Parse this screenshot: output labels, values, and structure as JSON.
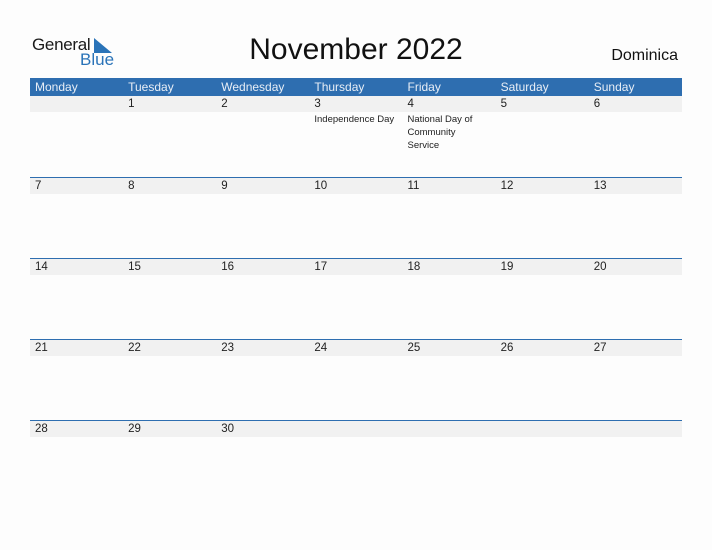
{
  "logo": {
    "word1": "General",
    "word2": "Blue",
    "icon": "triangle-flag-icon",
    "accent": "#2a73b8"
  },
  "header": {
    "title": "November 2022",
    "country": "Dominica"
  },
  "colors": {
    "header_bg": "#2e6eb0",
    "date_strip": "#f1f1f1",
    "row_rule": "#2e6eb0"
  },
  "weekdays": [
    "Monday",
    "Tuesday",
    "Wednesday",
    "Thursday",
    "Friday",
    "Saturday",
    "Sunday"
  ],
  "weeks": [
    {
      "days": [
        {
          "num": "",
          "event": ""
        },
        {
          "num": "1",
          "event": ""
        },
        {
          "num": "2",
          "event": ""
        },
        {
          "num": "3",
          "event": "Independence Day"
        },
        {
          "num": "4",
          "event": "National Day of Community Service"
        },
        {
          "num": "5",
          "event": ""
        },
        {
          "num": "6",
          "event": ""
        }
      ]
    },
    {
      "days": [
        {
          "num": "7",
          "event": ""
        },
        {
          "num": "8",
          "event": ""
        },
        {
          "num": "9",
          "event": ""
        },
        {
          "num": "10",
          "event": ""
        },
        {
          "num": "11",
          "event": ""
        },
        {
          "num": "12",
          "event": ""
        },
        {
          "num": "13",
          "event": ""
        }
      ]
    },
    {
      "days": [
        {
          "num": "14",
          "event": ""
        },
        {
          "num": "15",
          "event": ""
        },
        {
          "num": "16",
          "event": ""
        },
        {
          "num": "17",
          "event": ""
        },
        {
          "num": "18",
          "event": ""
        },
        {
          "num": "19",
          "event": ""
        },
        {
          "num": "20",
          "event": ""
        }
      ]
    },
    {
      "days": [
        {
          "num": "21",
          "event": ""
        },
        {
          "num": "22",
          "event": ""
        },
        {
          "num": "23",
          "event": ""
        },
        {
          "num": "24",
          "event": ""
        },
        {
          "num": "25",
          "event": ""
        },
        {
          "num": "26",
          "event": ""
        },
        {
          "num": "27",
          "event": ""
        }
      ]
    },
    {
      "days": [
        {
          "num": "28",
          "event": ""
        },
        {
          "num": "29",
          "event": ""
        },
        {
          "num": "30",
          "event": ""
        },
        {
          "num": "",
          "event": ""
        },
        {
          "num": "",
          "event": ""
        },
        {
          "num": "",
          "event": ""
        },
        {
          "num": "",
          "event": ""
        }
      ]
    }
  ]
}
